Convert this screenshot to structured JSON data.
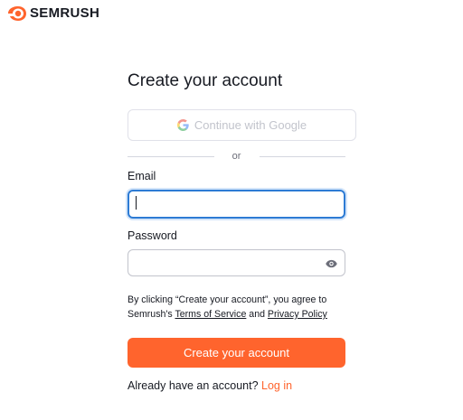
{
  "brand": {
    "name": "SEMRUSH",
    "accent": "#ff642d"
  },
  "form": {
    "title": "Create your account",
    "google_label": "Continue with Google",
    "divider": "or",
    "email_label": "Email",
    "email_value": "",
    "password_label": "Password",
    "password_value": "",
    "terms_prefix": "By clicking “Create your account”, you agree to Semrush's ",
    "terms_link": "Terms of Service",
    "terms_and": " and ",
    "privacy_link": "Privacy Policy",
    "submit_label": "Create your account",
    "login_prompt": "Already have an account?",
    "login_link": "Log in"
  },
  "icons": {
    "logo": "semrush-fire-logo-icon",
    "google": "google-g-icon",
    "password_toggle": "eye-icon"
  },
  "colors": {
    "primary": "#ff642d",
    "focus": "#2d7bd4",
    "border": "#c2c4cc"
  }
}
